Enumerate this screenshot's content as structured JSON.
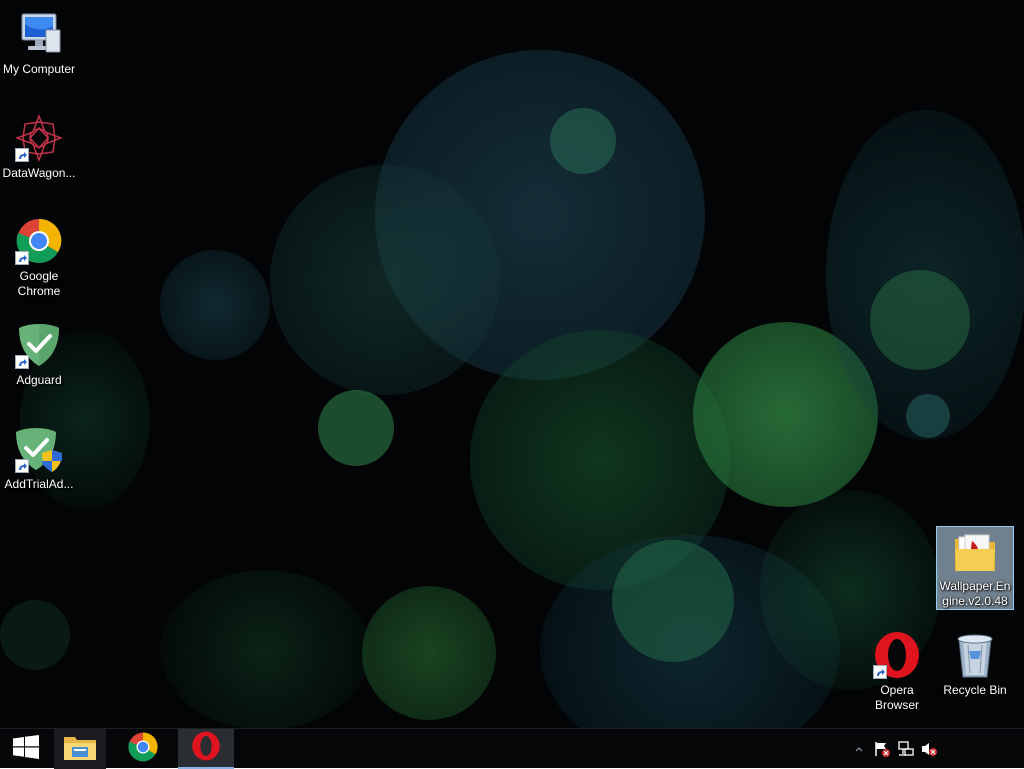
{
  "desktop": {
    "icons_left": [
      {
        "label": "My Computer",
        "icon": "computer-icon"
      },
      {
        "label": "DataWagon...",
        "icon": "datawagon-icon"
      },
      {
        "label": "Google Chrome",
        "icon": "chrome-icon"
      },
      {
        "label": "Adguard",
        "icon": "adguard-icon"
      },
      {
        "label": "AddTrialAd...",
        "icon": "adguard-uac-icon"
      }
    ],
    "icons_right": [
      {
        "label": "Wallpaper.Engine.v2.0.48",
        "icon": "folder-icon"
      },
      {
        "label": "Opera Browser",
        "icon": "opera-icon"
      },
      {
        "label": "Recycle Bin",
        "icon": "recycle-bin-icon"
      }
    ]
  },
  "taskbar": {
    "buttons": [
      {
        "name": "start",
        "icon": "windows-logo-icon"
      },
      {
        "name": "file-explorer",
        "icon": "file-explorer-icon"
      },
      {
        "name": "chrome",
        "icon": "chrome-icon"
      },
      {
        "name": "opera",
        "icon": "opera-icon"
      }
    ],
    "tray": [
      {
        "icon": "show-hidden-icons-chevron-icon"
      },
      {
        "icon": "action-center-flag-icon"
      },
      {
        "icon": "network-icon"
      },
      {
        "icon": "volume-muted-icon"
      }
    ]
  },
  "colors": {
    "taskbar": "#050608",
    "opera_red": "#e0141e",
    "adguard_green": "#67b279",
    "bokeh_green": "#2f8a3c",
    "bokeh_teal": "#1f5560"
  }
}
